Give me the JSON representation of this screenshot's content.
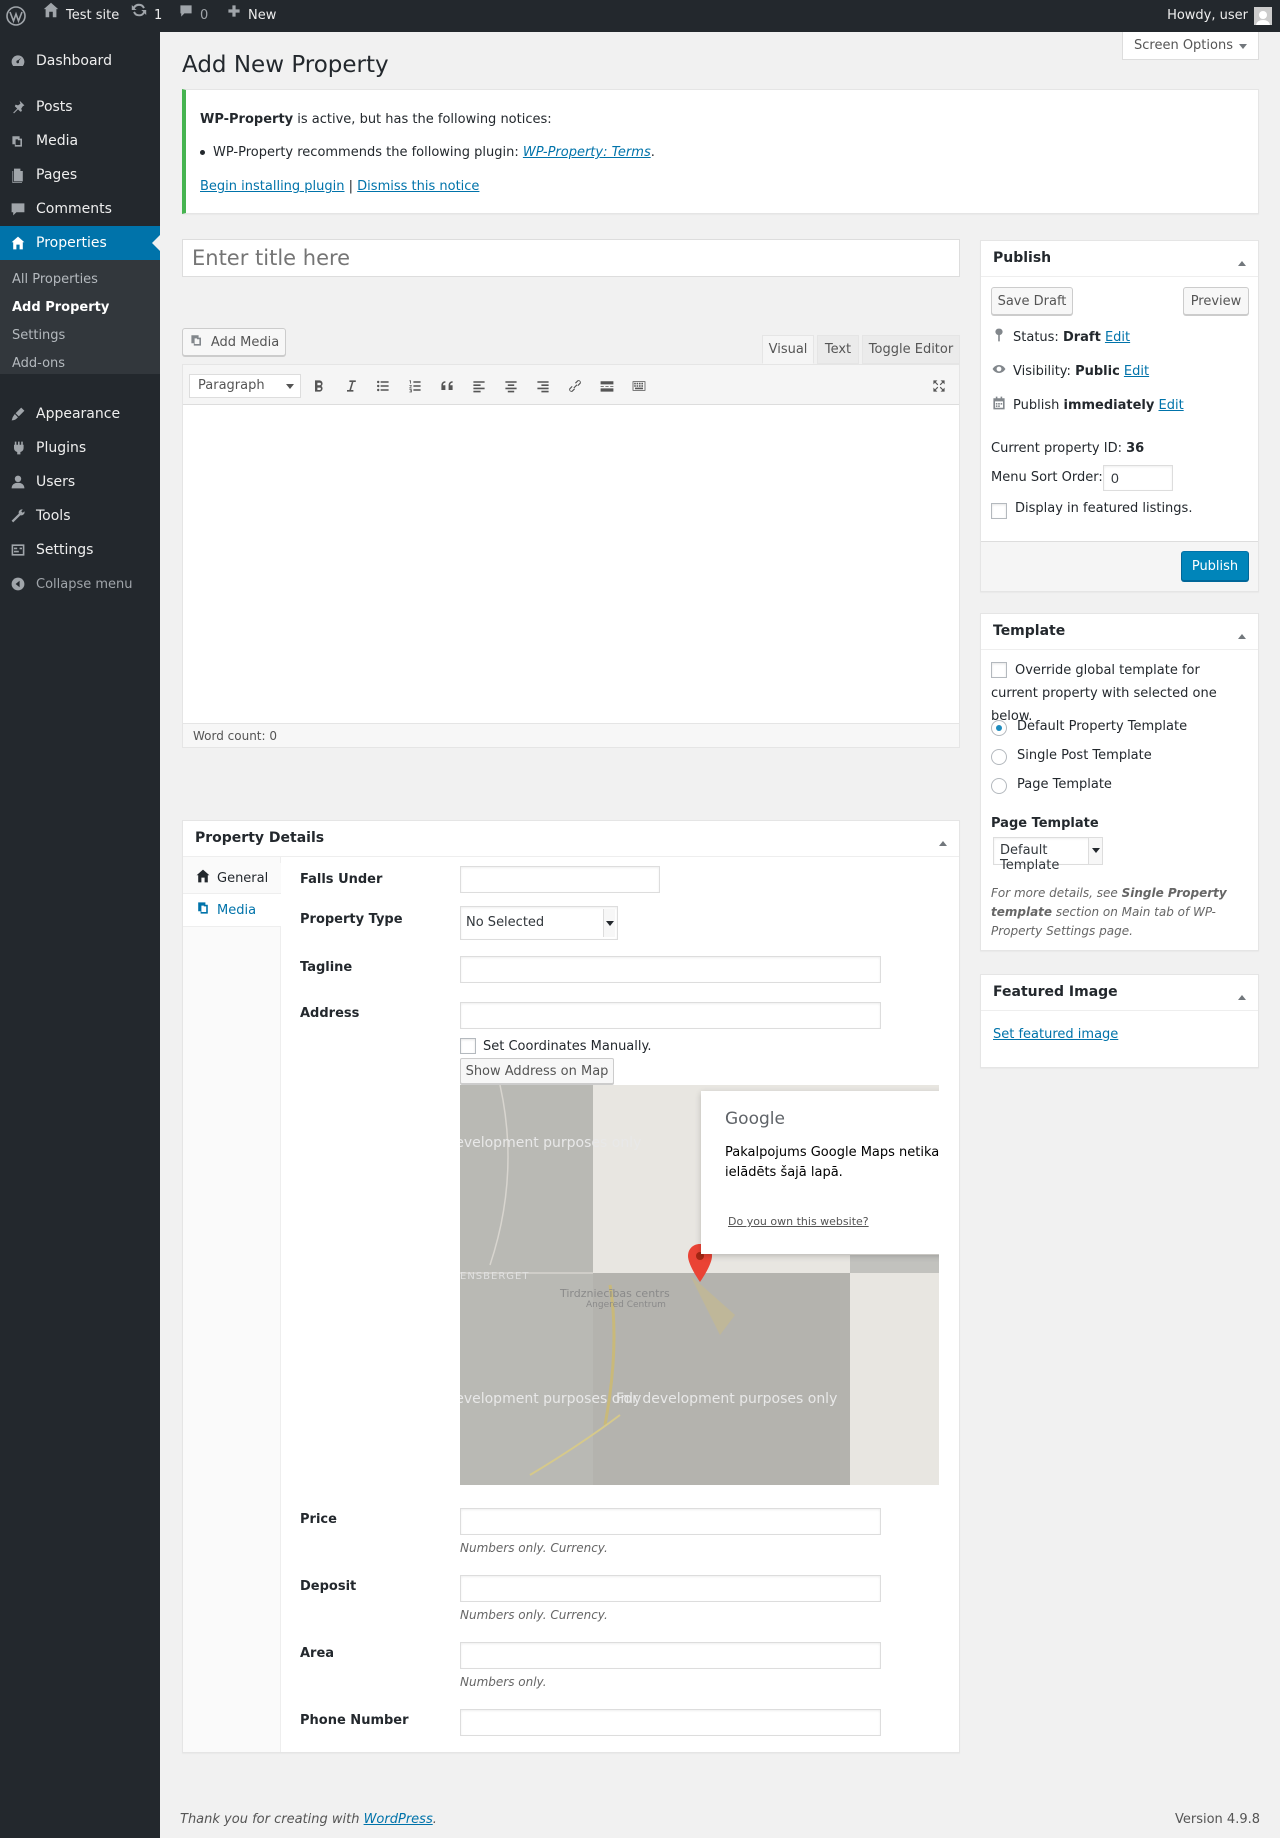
{
  "adminbar": {
    "site_name": "Test site",
    "updates_count": "1",
    "comments_count": "0",
    "new_label": "New",
    "howdy": "Howdy, user"
  },
  "sidemenu": {
    "items": [
      {
        "label": "Dashboard",
        "icon": "dashboard-icon"
      },
      {
        "label": "Posts",
        "icon": "pin-icon"
      },
      {
        "label": "Media",
        "icon": "media-icon"
      },
      {
        "label": "Pages",
        "icon": "page-icon"
      },
      {
        "label": "Comments",
        "icon": "comment-icon"
      },
      {
        "label": "Properties",
        "icon": "home-icon"
      },
      {
        "label": "Appearance",
        "icon": "brush-icon"
      },
      {
        "label": "Plugins",
        "icon": "plug-icon"
      },
      {
        "label": "Users",
        "icon": "user-icon"
      },
      {
        "label": "Tools",
        "icon": "wrench-icon"
      },
      {
        "label": "Settings",
        "icon": "settings-icon"
      },
      {
        "label": "Collapse menu",
        "icon": "collapse-icon"
      }
    ],
    "submenu": [
      "All Properties",
      "Add Property",
      "Settings",
      "Add-ons"
    ]
  },
  "screen_options": "Screen Options",
  "page_title": "Add New Property",
  "notice": {
    "plugin_name": "WP-Property",
    "line1_rest": " is active, but has the following notices:",
    "line2_text": "WP-Property recommends the following plugin: ",
    "line2_link": "WP-Property: Terms",
    "line2_end": ".",
    "install_link": "Begin installing plugin",
    "separator": " | ",
    "dismiss_link": "Dismiss this notice"
  },
  "title_placeholder": "Enter title here",
  "editor": {
    "add_media": "Add Media",
    "tabs": [
      "Visual",
      "Text",
      "Toggle Editor"
    ],
    "format": "Paragraph",
    "word_count": "Word count: 0"
  },
  "publish": {
    "title": "Publish",
    "save_draft": "Save Draft",
    "preview": "Preview",
    "status_label": "Status: ",
    "status_value": "Draft",
    "visibility_label": "Visibility: ",
    "visibility_value": "Public",
    "publish_label": "Publish ",
    "publish_value": "immediately",
    "edit": "Edit",
    "property_id_label": "Current property ID: ",
    "property_id": "36",
    "menu_sort_label": "Menu Sort Order:",
    "menu_sort_value": "0",
    "featured_label": "Display in featured listings.",
    "publish_button": "Publish"
  },
  "template": {
    "title": "Template",
    "override_label": "Override global template for current property with selected one below.",
    "options": [
      "Default Property Template",
      "Single Post Template",
      "Page Template"
    ],
    "selected": "Default Property Template",
    "page_template_label": "Page Template",
    "page_template_value": "Default Template",
    "help_pre": "For more details, see ",
    "help_bold": "Single Property template",
    "help_post": " section on Main tab of WP-Property Settings page."
  },
  "featured_image": {
    "title": "Featured Image",
    "link": "Set featured image"
  },
  "property_details": {
    "title": "Property Details",
    "tabs": [
      {
        "label": "General",
        "icon": "home-icon"
      },
      {
        "label": "Media",
        "icon": "media-icon"
      }
    ],
    "falls_under": "Falls Under",
    "property_type": "Property Type",
    "property_type_value": "No Selected",
    "tagline": "Tagline",
    "address": "Address",
    "set_coords": "Set Coordinates Manually.",
    "show_address": "Show Address on Map",
    "price": "Price",
    "deposit": "Deposit",
    "area": "Area",
    "phone": "Phone Number",
    "hint_currency": "Numbers only. Currency.",
    "hint_numbers": "Numbers only."
  },
  "map": {
    "google_label": "Google",
    "error_text": "Pakalpojums Google Maps netika ielādēts šajā lapā.",
    "own_site": "Do you own this website?",
    "dev_text": "For development purposes only",
    "place_name": "Tirdzniecības centrs",
    "place_sub": "Angered Centrum",
    "area_name": "ENSBERGET"
  },
  "footer": {
    "thanks": "Thank you for creating with ",
    "wp_link": "WordPress",
    "dot": ".",
    "version": "Version 4.9.8"
  }
}
